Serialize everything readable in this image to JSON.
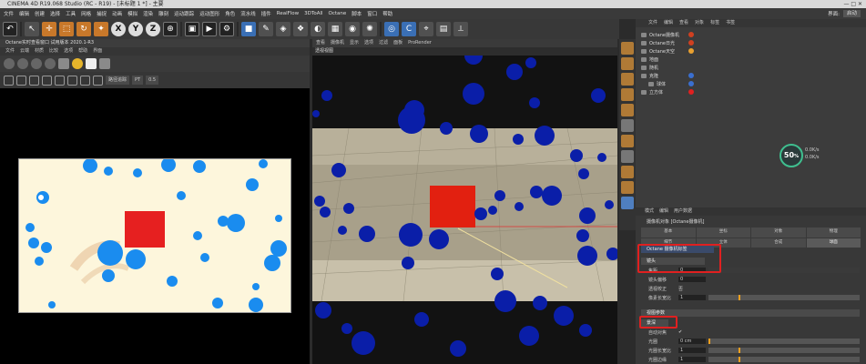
{
  "titlebar": {
    "title": "CINEMA 4D R19.068 Studio (RC - R19) - [未标题 1 *] - 主要",
    "controls": "—  □  ✕"
  },
  "menubar": {
    "items": [
      "文件",
      "编辑",
      "创建",
      "选择",
      "工具",
      "网格",
      "捕捉",
      "动画",
      "模拟",
      "渲染",
      "雕刻",
      "运动跟踪",
      "运动图形",
      "角色",
      "流水线",
      "插件",
      "RealFlow",
      "3DToAll",
      "Octane",
      "脚本",
      "窗口",
      "帮助"
    ],
    "layout_label": "界面:",
    "layout_value": "启动"
  },
  "toolbar": {
    "icons": [
      "undo-icon",
      "pointer-icon",
      "move-icon",
      "scale-icon",
      "rotate-icon",
      "select-icon",
      "x-axis-icon",
      "y-axis-icon",
      "z-axis-icon",
      "world-coord-icon",
      "render-view-icon",
      "render-icon",
      "render-settings-icon",
      "cube-icon",
      "pen-icon",
      "subdivision-icon",
      "cloner-icon",
      "deformer-icon",
      "scene-icon",
      "camera-icon",
      "light-icon",
      "octane-icon",
      "c-icon",
      "snap-icon",
      "grid-icon",
      "axis-icon"
    ],
    "xyz": [
      "X",
      "Y",
      "Z"
    ]
  },
  "left_panel": {
    "title": "Octane实时查看窗口 试用版本 2020.1-R3",
    "menu": [
      "文件",
      "云端",
      "材质",
      "比较",
      "选项",
      "帮助",
      "界面"
    ],
    "dropdown1": "路径追踪",
    "dropdown2": "PT",
    "dropdown3": "0.5"
  },
  "viewport": {
    "menu": [
      "查看",
      "摄像机",
      "显示",
      "选项",
      "过滤",
      "面板",
      "ProRender"
    ],
    "tab": "透视视图"
  },
  "object_manager": {
    "menu": [
      "文件",
      "编辑",
      "查看",
      "对象",
      "标签",
      "书签"
    ],
    "rows": [
      {
        "name": "Octane摄像机",
        "color": "#d04020"
      },
      {
        "name": "Octane日光",
        "color": "#d04020"
      },
      {
        "name": "Octane天空",
        "color": "#e8a030"
      },
      {
        "name": "地面",
        "color": "#888888"
      },
      {
        "name": "随机",
        "color": "#888888"
      },
      {
        "name": "克隆",
        "color": "#3a6fd0"
      },
      {
        "name": "球体",
        "color": "#3a6fd0"
      },
      {
        "name": "立方体",
        "color": "#e02020"
      }
    ]
  },
  "stats": {
    "percent": "50",
    "unit": "%",
    "line1": "0.0K/s",
    "line2": "0.0K/s"
  },
  "attributes": {
    "menu": [
      "模式",
      "编辑",
      "用户数据"
    ],
    "title": "摄像机对象 [Octane摄像机]",
    "tabs": [
      "基本",
      "坐标",
      "对象",
      "物理",
      "细节",
      "立体",
      "合成",
      "球面"
    ],
    "camera_type_label": "Octane 摄像机标签",
    "section1": "镜头",
    "rows1": [
      {
        "label": "焦距",
        "value": "0"
      },
      {
        "label": "镜头偏移",
        "value": "0"
      },
      {
        "label": "透视校正",
        "value": "否"
      },
      {
        "label": "像素长宽比",
        "value": "1"
      }
    ],
    "section2": "视图参数",
    "section3": "景深",
    "rows2": [
      {
        "label": "自动对焦",
        "value": "✔"
      },
      {
        "label": "光圈",
        "value": "0 cm"
      },
      {
        "label": "光圈长宽比",
        "value": "1"
      },
      {
        "label": "光圈边缘",
        "value": "1"
      }
    ]
  }
}
